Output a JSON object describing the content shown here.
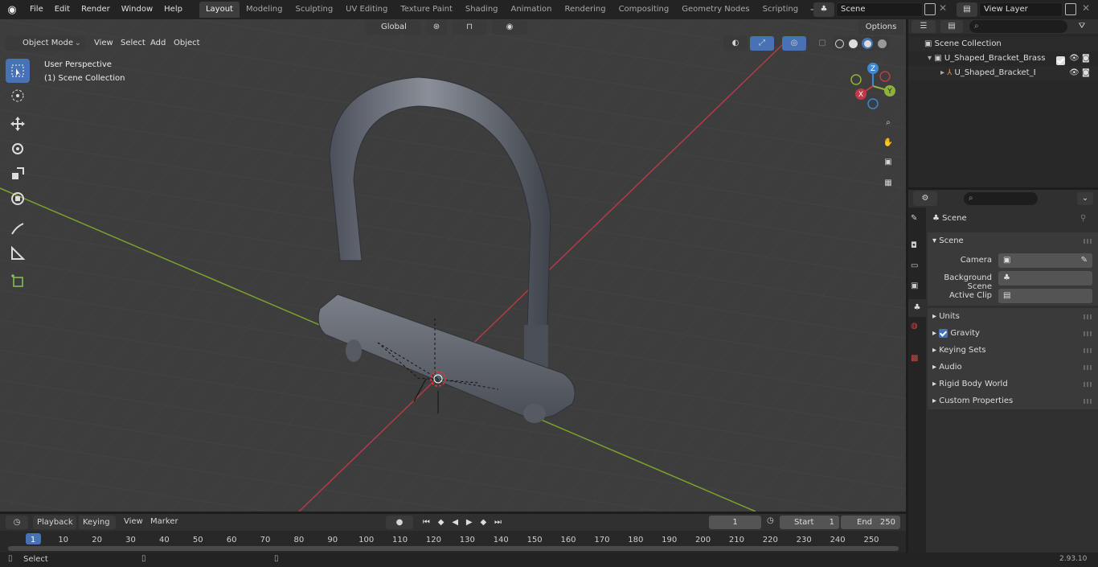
{
  "topbar": {
    "menus": [
      "File",
      "Edit",
      "Render",
      "Window",
      "Help"
    ],
    "workspaces": [
      "Layout",
      "Modeling",
      "Sculpting",
      "UV Editing",
      "Texture Paint",
      "Shading",
      "Animation",
      "Rendering",
      "Compositing",
      "Geometry Nodes",
      "Scripting"
    ],
    "active_workspace": "Layout",
    "scene_name": "Scene",
    "view_layer": "View Layer"
  },
  "viewport_header": {
    "mode": "Object Mode",
    "menus": [
      "View",
      "Select",
      "Add",
      "Object"
    ],
    "orientation": "Global",
    "options_label": "Options"
  },
  "viewport": {
    "perspective": "User Perspective",
    "collection": "(1) Scene Collection",
    "gizmo_axes": [
      "Z",
      "Y",
      "X"
    ]
  },
  "outliner": {
    "root": "Scene Collection",
    "collection": "U_Shaped_Bracket_Brass",
    "object": "U_Shaped_Bracket_Brass"
  },
  "properties": {
    "breadcrumb": "Scene",
    "panel_title": "Scene",
    "fields": [
      {
        "label": "Camera"
      },
      {
        "label": "Background Scene"
      },
      {
        "label": "Active Clip"
      }
    ],
    "subpanels": [
      "Units",
      "Gravity",
      "Keying Sets",
      "Audio",
      "Rigid Body World",
      "Custom Properties"
    ]
  },
  "timeline": {
    "menus": [
      "Playback",
      "Keying",
      "View",
      "Marker"
    ],
    "current_frame": "1",
    "start_label": "Start",
    "start_value": "1",
    "end_label": "End",
    "end_value": "250",
    "ticks": [
      "1",
      "10",
      "20",
      "30",
      "40",
      "50",
      "60",
      "70",
      "80",
      "90",
      "100",
      "110",
      "120",
      "130",
      "140",
      "150",
      "160",
      "170",
      "180",
      "190",
      "200",
      "210",
      "220",
      "230",
      "240",
      "250"
    ]
  },
  "statusbar": {
    "action": "Select",
    "version": "2.93.10"
  },
  "colors": {
    "accent": "#4772b3",
    "x_axis": "#c0394b",
    "y_axis": "#8db33a",
    "z_axis": "#3d87d4"
  }
}
